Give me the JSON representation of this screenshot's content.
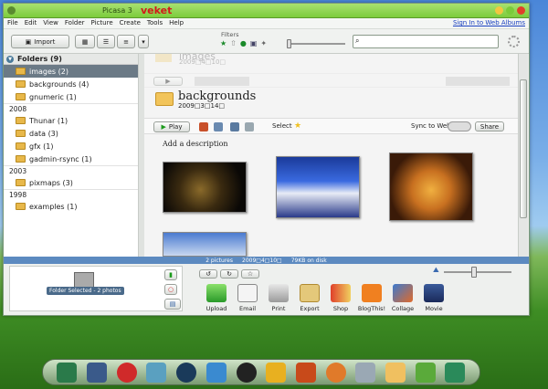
{
  "window": {
    "title": "Picasa 3",
    "theme_name": "veket"
  },
  "menu": [
    "File",
    "Edit",
    "View",
    "Folder",
    "Picture",
    "Create",
    "Tools",
    "Help"
  ],
  "signin": "Sign In to Web Albums",
  "toolbar": {
    "import": "Import",
    "filters": "Filters",
    "search_value": ""
  },
  "sidebar": {
    "header": "Folders (9)",
    "groups": [
      {
        "year": "",
        "items": [
          {
            "name": "images (2)",
            "selected": true
          },
          {
            "name": "backgrounds (4)"
          },
          {
            "name": "gnumeric (1)"
          }
        ]
      },
      {
        "year": "2008",
        "items": [
          {
            "name": "Thunar (1)"
          },
          {
            "name": "data (3)"
          },
          {
            "name": "gfx (1)"
          },
          {
            "name": "gadmin-rsync (1)"
          }
        ]
      },
      {
        "year": "2003",
        "items": [
          {
            "name": "pixmaps (3)"
          }
        ]
      },
      {
        "year": "1998",
        "items": [
          {
            "name": "examples (1)"
          }
        ]
      }
    ]
  },
  "ghost_folder": {
    "title": "images",
    "date": "2009□4□10□"
  },
  "folder": {
    "title": "backgrounds",
    "date": "2009□3□14□",
    "play": "Play",
    "select": "Select",
    "sync": "Sync to Web",
    "share": "Share",
    "description": "Add a description"
  },
  "status": {
    "pictures": "2 pictures",
    "date": "2009□4□10□",
    "size": "79KB on disk"
  },
  "tray_tooltip": "Folder Selected - 2 photos",
  "actions": [
    "Upload",
    "Email",
    "Print",
    "Export",
    "Shop",
    "BlogThis!",
    "Collage",
    "Movie"
  ],
  "colors": {
    "accent": "#7ccc3c",
    "selected": "#6b7a86",
    "statusbar": "#5c8ac0"
  }
}
